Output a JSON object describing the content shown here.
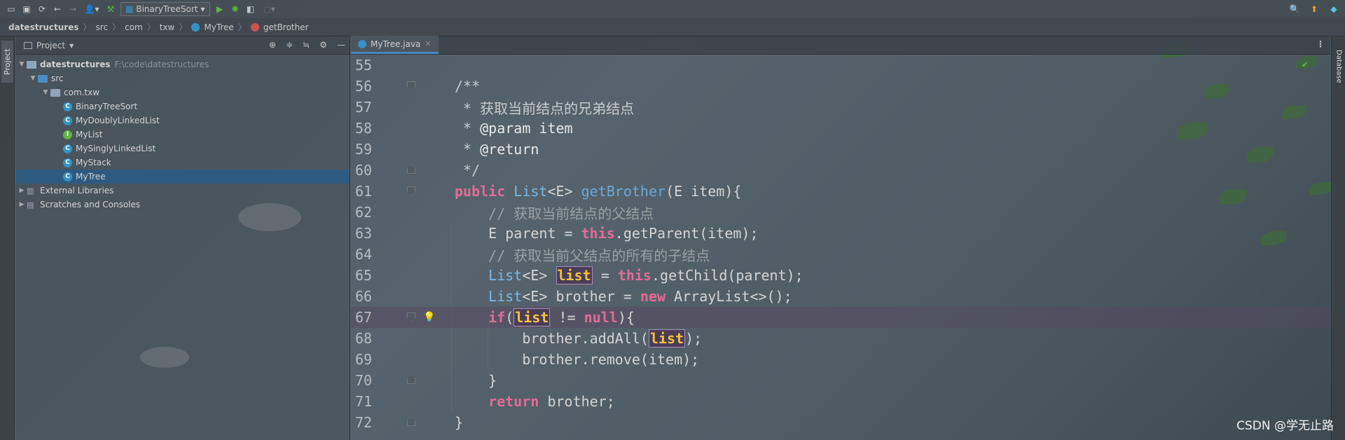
{
  "toolbar": {
    "run_config": "BinaryTreeSort",
    "icons": [
      "folder-open-icon",
      "save-icon",
      "sync-icon",
      "back-arrow-icon",
      "forward-arrow-icon",
      "user-icon",
      "build-hammer-icon",
      "run-icon",
      "debug-icon",
      "coverage-icon",
      "profiler-icon",
      "search-icon",
      "update-icon",
      "plugin-icon"
    ]
  },
  "breadcrumb": {
    "items": [
      "datestructures",
      "src",
      "com",
      "txw",
      "MyTree",
      "getBrother"
    ]
  },
  "left_strip": {
    "label": "Project"
  },
  "right_strip": {
    "label": "Database"
  },
  "project_panel": {
    "title": "Project",
    "tree": {
      "root_label": "datestructures",
      "root_path": "F:\\code\\datestructures",
      "src_label": "src",
      "package_label": "com.txw",
      "classes": [
        {
          "label": "BinaryTreeSort",
          "kind": "C"
        },
        {
          "label": "MyDoublyLinkedList",
          "kind": "C"
        },
        {
          "label": "MyList",
          "kind": "I"
        },
        {
          "label": "MySinglyLinkedList",
          "kind": "C"
        },
        {
          "label": "MyStack",
          "kind": "C"
        },
        {
          "label": "MyTree",
          "kind": "C"
        }
      ],
      "external_libraries": "External Libraries",
      "scratches": "Scratches and Consoles"
    }
  },
  "editor": {
    "tab_label": "MyTree.java",
    "line_numbers": [
      "55",
      "56",
      "57",
      "58",
      "59",
      "60",
      "61",
      "62",
      "63",
      "64",
      "65",
      "66",
      "67",
      "68",
      "69",
      "70",
      "71",
      "72"
    ],
    "watermark": "CSDN @学无止路"
  }
}
